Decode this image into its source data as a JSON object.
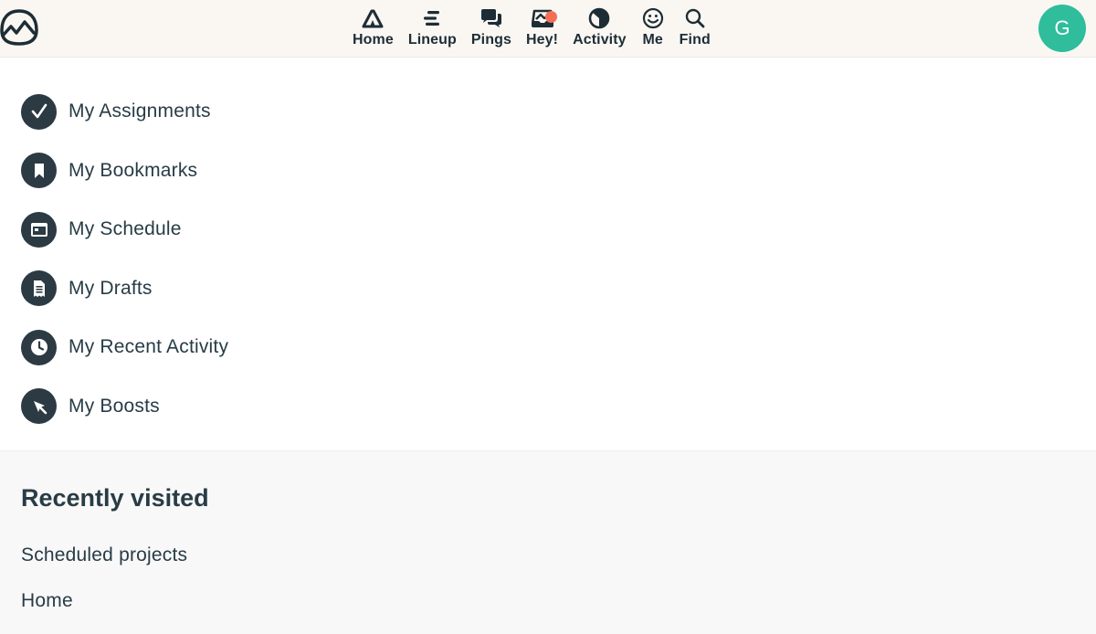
{
  "header": {
    "logo_icon": "basecamp-logo-icon",
    "nav": [
      {
        "label": "Home",
        "icon": "home-icon"
      },
      {
        "label": "Lineup",
        "icon": "lineup-icon"
      },
      {
        "label": "Pings",
        "icon": "pings-icon"
      },
      {
        "label": "Hey!",
        "icon": "hey-icon",
        "notification": true
      },
      {
        "label": "Activity",
        "icon": "activity-icon"
      },
      {
        "label": "Me",
        "icon": "me-icon"
      },
      {
        "label": "Find",
        "icon": "find-icon"
      }
    ],
    "avatar_initial": "G",
    "avatar_color": "#2fbd9c",
    "notification_color": "#f46e55"
  },
  "my_menu": [
    {
      "label": "My Assignments",
      "icon": "checkmark-icon"
    },
    {
      "label": "My Bookmarks",
      "icon": "bookmark-icon"
    },
    {
      "label": "My Schedule",
      "icon": "calendar-icon"
    },
    {
      "label": "My Drafts",
      "icon": "document-icon"
    },
    {
      "label": "My Recent Activity",
      "icon": "clock-icon"
    },
    {
      "label": "My Boosts",
      "icon": "rocket-icon"
    }
  ],
  "recently_visited": {
    "title": "Recently visited",
    "links": [
      "Scheduled projects",
      "Home"
    ]
  }
}
